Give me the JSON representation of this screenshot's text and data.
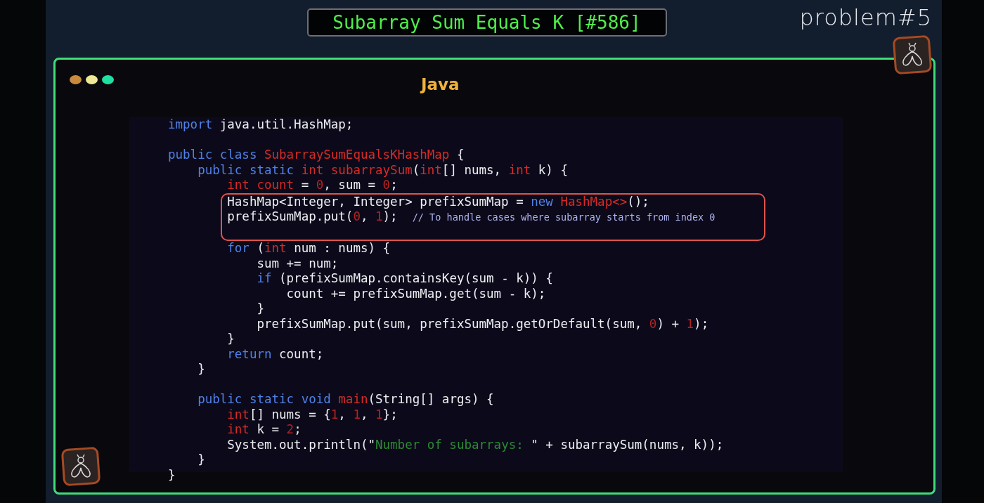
{
  "title": "Subarray Sum Equals K [#586]",
  "problem_label": "problem#5",
  "window": {
    "dots": [
      {
        "color": "#c98a3e"
      },
      {
        "color": "#eee795"
      },
      {
        "color": "#1fe0a0"
      }
    ],
    "language": "Java"
  },
  "code_blocks": [
    {
      "highlighted": false,
      "lines": [
        {
          "kind": "code",
          "tokens": [
            {
              "kind": "keyword",
              "text": "import"
            },
            {
              "kind": "plain",
              "text": " java.util.HashMap;"
            }
          ]
        },
        {
          "kind": "blank"
        },
        {
          "kind": "code",
          "tokens": [
            {
              "kind": "keyword",
              "text": "public class"
            },
            {
              "kind": "type",
              "text": " SubarraySumEqualsKHashMap"
            },
            {
              "kind": "plain",
              "text": " {"
            }
          ]
        },
        {
          "kind": "code",
          "tokens": [
            {
              "kind": "keyword",
              "text": "    public static"
            },
            {
              "kind": "type",
              "text": " int subarraySum"
            },
            {
              "kind": "plain",
              "text": "("
            },
            {
              "kind": "type",
              "text": "int"
            },
            {
              "kind": "plain",
              "text": "[] nums, "
            },
            {
              "kind": "type",
              "text": "int"
            },
            {
              "kind": "plain",
              "text": " k) {"
            }
          ]
        },
        {
          "kind": "code",
          "tokens": [
            {
              "kind": "type",
              "text": "        int count"
            },
            {
              "kind": "plain",
              "text": " = "
            },
            {
              "kind": "number",
              "text": "0"
            },
            {
              "kind": "plain",
              "text": ", sum = "
            },
            {
              "kind": "number",
              "text": "0"
            },
            {
              "kind": "plain",
              "text": ";"
            }
          ]
        }
      ]
    },
    {
      "highlighted": true,
      "lines": [
        {
          "kind": "code",
          "tokens": [
            {
              "kind": "plain",
              "text": "        HashMap<Integer, Integer> prefixSumMap = "
            },
            {
              "kind": "keyword",
              "text": "new"
            },
            {
              "kind": "type",
              "text": " HashMap<>"
            },
            {
              "kind": "plain",
              "text": "();"
            }
          ]
        },
        {
          "kind": "code",
          "tokens": [
            {
              "kind": "plain",
              "text": "        prefixSumMap.put("
            },
            {
              "kind": "number",
              "text": "0"
            },
            {
              "kind": "plain",
              "text": ", "
            },
            {
              "kind": "number",
              "text": "1"
            },
            {
              "kind": "plain",
              "text": ");  "
            },
            {
              "kind": "comment",
              "text": "// To handle cases where subarray starts from index 0"
            }
          ]
        },
        {
          "kind": "blank"
        }
      ]
    },
    {
      "highlighted": false,
      "lines": [
        {
          "kind": "code",
          "tokens": [
            {
              "kind": "keyword",
              "text": "        for"
            },
            {
              "kind": "plain",
              "text": " ("
            },
            {
              "kind": "type",
              "text": "int"
            },
            {
              "kind": "plain",
              "text": " num : nums) {"
            }
          ]
        },
        {
          "kind": "code",
          "tokens": [
            {
              "kind": "plain",
              "text": "            sum += num;"
            }
          ]
        },
        {
          "kind": "code",
          "tokens": [
            {
              "kind": "keyword",
              "text": "            if"
            },
            {
              "kind": "plain",
              "text": " (prefixSumMap.containsKey(sum - k)) {"
            }
          ]
        },
        {
          "kind": "code",
          "tokens": [
            {
              "kind": "plain",
              "text": "                count += prefixSumMap.get(sum - k);"
            }
          ]
        },
        {
          "kind": "code",
          "tokens": [
            {
              "kind": "plain",
              "text": "            }"
            }
          ]
        },
        {
          "kind": "code",
          "tokens": [
            {
              "kind": "plain",
              "text": "            prefixSumMap.put(sum, prefixSumMap.getOrDefault(sum, "
            },
            {
              "kind": "number",
              "text": "0"
            },
            {
              "kind": "plain",
              "text": ") + "
            },
            {
              "kind": "number",
              "text": "1"
            },
            {
              "kind": "plain",
              "text": ");"
            }
          ]
        },
        {
          "kind": "code",
          "tokens": [
            {
              "kind": "plain",
              "text": "        }"
            }
          ]
        },
        {
          "kind": "code",
          "tokens": [
            {
              "kind": "keyword",
              "text": "        return"
            },
            {
              "kind": "plain",
              "text": " count;"
            }
          ]
        },
        {
          "kind": "code",
          "tokens": [
            {
              "kind": "plain",
              "text": "    }"
            }
          ]
        },
        {
          "kind": "blank"
        },
        {
          "kind": "code",
          "tokens": [
            {
              "kind": "keyword",
              "text": "    public static void"
            },
            {
              "kind": "type",
              "text": " main"
            },
            {
              "kind": "plain",
              "text": "(String[] args) {"
            }
          ]
        },
        {
          "kind": "code",
          "tokens": [
            {
              "kind": "type",
              "text": "        int"
            },
            {
              "kind": "plain",
              "text": "[] nums = {"
            },
            {
              "kind": "number",
              "text": "1"
            },
            {
              "kind": "plain",
              "text": ", "
            },
            {
              "kind": "number",
              "text": "1"
            },
            {
              "kind": "plain",
              "text": ", "
            },
            {
              "kind": "number",
              "text": "1"
            },
            {
              "kind": "plain",
              "text": "};"
            }
          ]
        },
        {
          "kind": "code",
          "tokens": [
            {
              "kind": "type",
              "text": "        int"
            },
            {
              "kind": "plain",
              "text": " k = "
            },
            {
              "kind": "number",
              "text": "2"
            },
            {
              "kind": "plain",
              "text": ";"
            }
          ]
        },
        {
          "kind": "code",
          "tokens": [
            {
              "kind": "plain",
              "text": "        System.out.println(\""
            },
            {
              "kind": "string",
              "text": "Number of subarrays: "
            },
            {
              "kind": "plain",
              "text": "\" + subarraySum(nums, k));"
            }
          ]
        },
        {
          "kind": "code",
          "tokens": [
            {
              "kind": "plain",
              "text": "    }"
            }
          ]
        },
        {
          "kind": "code",
          "tokens": [
            {
              "kind": "plain",
              "text": "}"
            }
          ]
        }
      ]
    }
  ]
}
